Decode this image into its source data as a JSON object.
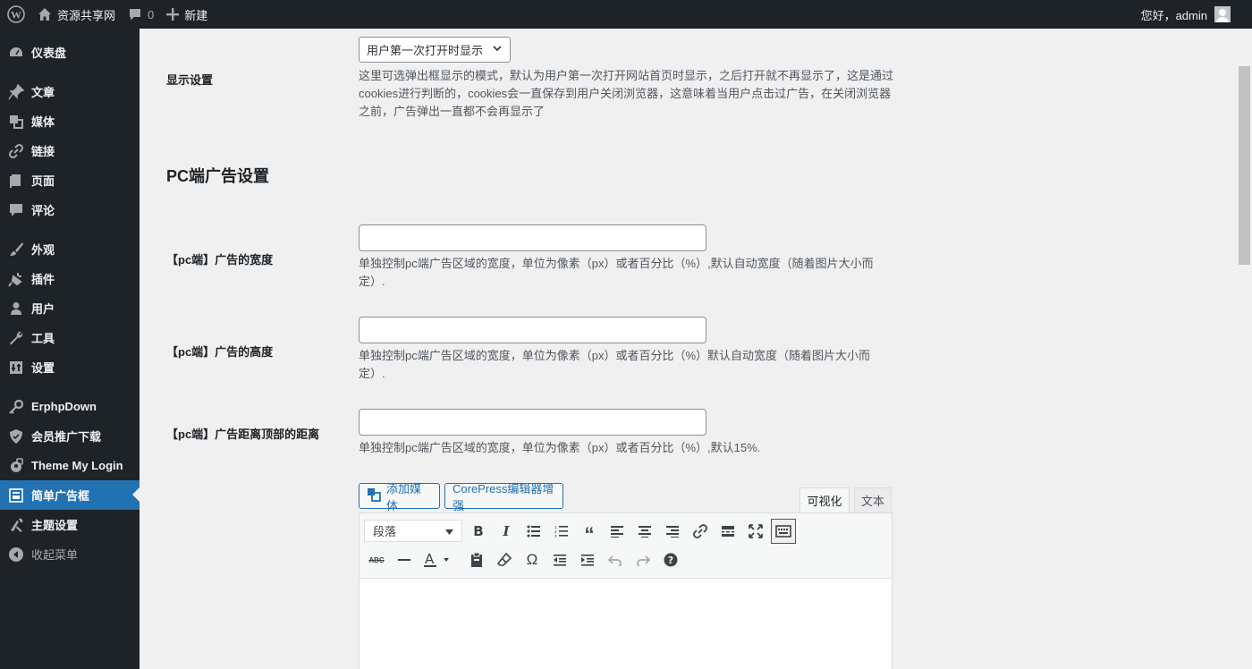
{
  "admin_bar": {
    "site_name": "资源共享网",
    "comments_count": "0",
    "new_label": "新建",
    "greeting": "您好，admin"
  },
  "sidebar": {
    "items": [
      {
        "label": "仪表盘",
        "icon": "dashboard-icon"
      },
      {
        "label": "文章",
        "icon": "pin-icon"
      },
      {
        "label": "媒体",
        "icon": "media-icon"
      },
      {
        "label": "链接",
        "icon": "link-icon"
      },
      {
        "label": "页面",
        "icon": "page-icon"
      },
      {
        "label": "评论",
        "icon": "comment-icon"
      },
      {
        "label": "外观",
        "icon": "brush-icon"
      },
      {
        "label": "插件",
        "icon": "plugin-icon"
      },
      {
        "label": "用户",
        "icon": "user-icon"
      },
      {
        "label": "工具",
        "icon": "wrench-icon"
      },
      {
        "label": "设置",
        "icon": "settings-icon"
      },
      {
        "label": "ErphpDown",
        "icon": "key-icon"
      },
      {
        "label": "会员推广下载",
        "icon": "shield-icon"
      },
      {
        "label": "Theme My Login",
        "icon": "lock-user-icon"
      },
      {
        "label": "简单广告框",
        "icon": "ad-box-icon",
        "active": true
      },
      {
        "label": "主题设置",
        "icon": "tools-icon"
      },
      {
        "label": "收起菜单",
        "icon": "collapse-icon"
      }
    ]
  },
  "main": {
    "display_setting": {
      "label": "显示设置",
      "select_value": "用户第一次打开时显示",
      "description": "这里可选弹出框显示的模式，默认为用户第一次打开网站首页时显示，之后打开就不再显示了，这是通过cookies进行判断的，cookies会一直保存到用户关闭浏览器，这意味着当用户点击过广告，在关闭浏览器之前，广告弹出一直都不会再显示了"
    },
    "section_title": "PC端广告设置",
    "fields": [
      {
        "label": "【pc端】广告的宽度",
        "value": "",
        "description": "单独控制pc端广告区域的宽度，单位为像素（px）或者百分比（%）,默认自动宽度（随着图片大小而定）."
      },
      {
        "label": "【pc端】广告的高度",
        "value": "",
        "description": "单独控制pc端广告区域的宽度，单位为像素（px）或者百分比（%）默认自动宽度（随着图片大小而定）."
      },
      {
        "label": "【pc端】广告距离顶部的距离",
        "value": "",
        "description": "单独控制pc端广告区域的宽度，单位为像素（px）或者百分比（%）,默认15%."
      }
    ],
    "editor": {
      "add_media": "添加媒体",
      "corepress": "CorePress编辑器增强",
      "tab_visual": "可视化",
      "tab_text": "文本",
      "format_select": "段落"
    }
  }
}
